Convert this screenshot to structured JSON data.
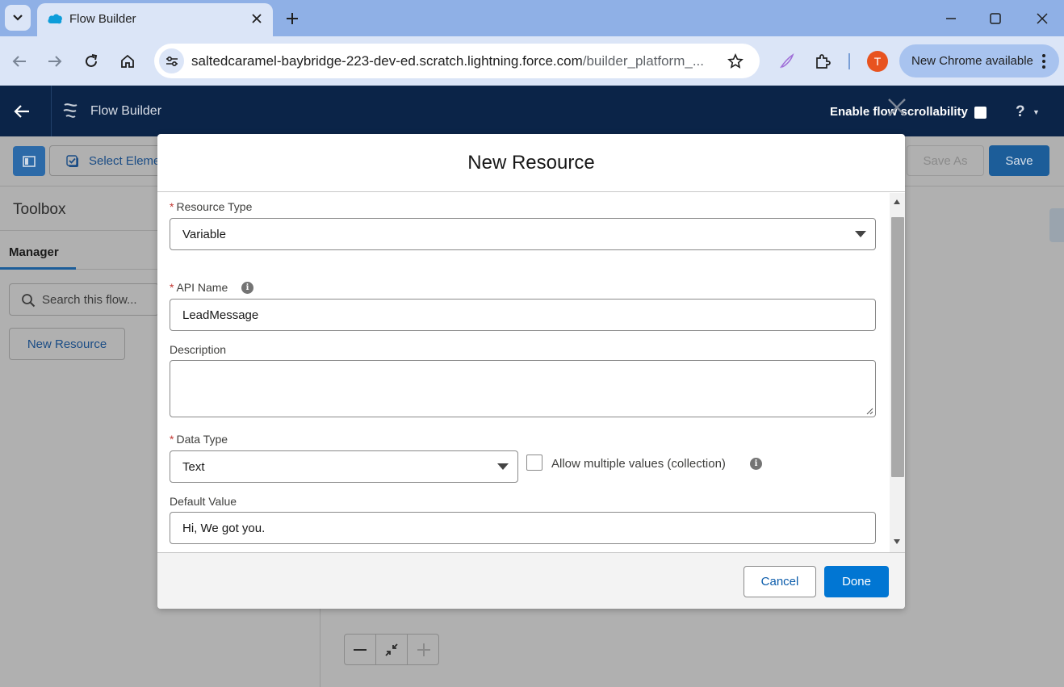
{
  "browser": {
    "tab_title": "Flow Builder",
    "url_host": "saltedcaramel-baybridge-223-dev-ed.scratch.lightning.force.com",
    "url_path": "/builder_platform_...",
    "profile_initial": "T",
    "update_label": "New Chrome available"
  },
  "header": {
    "title": "Flow Builder",
    "scrollability_label": "Enable flow scrollability",
    "help_glyph": "?"
  },
  "builder_toolbar": {
    "select_elements_label": "Select Eleme",
    "save_as_label": "Save As",
    "save_label": "Save"
  },
  "left_panel": {
    "toolbox_title": "Toolbox",
    "manager_tab": "Manager",
    "search_placeholder": "Search this flow...",
    "new_resource_button": "New Resource"
  },
  "modal": {
    "title": "New Resource",
    "required_mark": "*",
    "resource_type": {
      "label": "Resource Type",
      "value": "Variable"
    },
    "api_name": {
      "label": "API Name",
      "value": "LeadMessage"
    },
    "description": {
      "label": "Description",
      "value": ""
    },
    "data_type": {
      "label": "Data Type",
      "value": "Text"
    },
    "allow_multiple": {
      "label": "Allow multiple values (collection)",
      "checked": false
    },
    "default_value": {
      "label": "Default Value",
      "value": "Hi, We got you."
    },
    "info_glyph": "i",
    "cancel_label": "Cancel",
    "done_label": "Done"
  },
  "colors": {
    "brand_blue": "#0176d3",
    "header_navy": "#0b2448",
    "required_red": "#c23934",
    "chrome_tab_strip": "#8fb0e6",
    "chrome_toolbar": "#dbe5f7"
  }
}
